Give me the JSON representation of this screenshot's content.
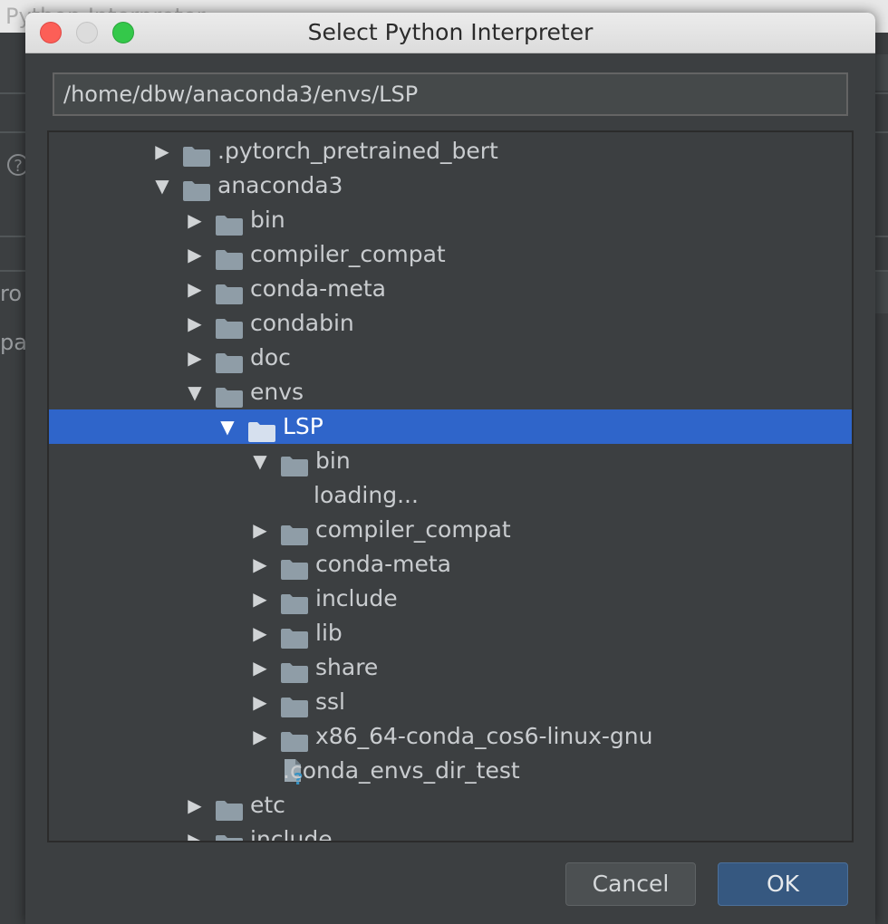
{
  "background_window": {
    "title_fragment": "Python Interpreter",
    "side_text_1": "ro",
    "side_text_2": "pa",
    "help_icon": "?"
  },
  "dialog": {
    "title": "Select Python Interpreter",
    "path_value": "/home/dbw/anaconda3/envs/LSP",
    "cancel_label": "Cancel",
    "ok_label": "OK"
  },
  "colors": {
    "selection": "#2f65ca",
    "folder": "#8f9da7",
    "ok_button": "#365880"
  },
  "tree": [
    {
      "label": ".pytorch_pretrained_bert",
      "state": "collapsed",
      "type": "folder"
    },
    {
      "label": "anaconda3",
      "state": "expanded",
      "type": "folder"
    },
    {
      "label": "bin",
      "state": "collapsed",
      "type": "folder"
    },
    {
      "label": "compiler_compat",
      "state": "collapsed",
      "type": "folder"
    },
    {
      "label": "conda-meta",
      "state": "collapsed",
      "type": "folder"
    },
    {
      "label": "condabin",
      "state": "collapsed",
      "type": "folder"
    },
    {
      "label": "doc",
      "state": "collapsed",
      "type": "folder"
    },
    {
      "label": "envs",
      "state": "expanded",
      "type": "folder"
    },
    {
      "label": "LSP",
      "state": "expanded",
      "type": "folder",
      "selected": true
    },
    {
      "label": "bin",
      "state": "expanded",
      "type": "folder"
    },
    {
      "label": "loading...",
      "state": "none",
      "type": "text"
    },
    {
      "label": "compiler_compat",
      "state": "collapsed",
      "type": "folder"
    },
    {
      "label": "conda-meta",
      "state": "collapsed",
      "type": "folder"
    },
    {
      "label": "include",
      "state": "collapsed",
      "type": "folder"
    },
    {
      "label": "lib",
      "state": "collapsed",
      "type": "folder"
    },
    {
      "label": "share",
      "state": "collapsed",
      "type": "folder"
    },
    {
      "label": "ssl",
      "state": "collapsed",
      "type": "folder"
    },
    {
      "label": "x86_64-conda_cos6-linux-gnu",
      "state": "collapsed",
      "type": "folder"
    },
    {
      "label": ".conda_envs_dir_test",
      "state": "none",
      "type": "unknown-file"
    },
    {
      "label": "etc",
      "state": "collapsed",
      "type": "folder"
    },
    {
      "label": "include",
      "state": "collapsed",
      "type": "folder"
    }
  ]
}
